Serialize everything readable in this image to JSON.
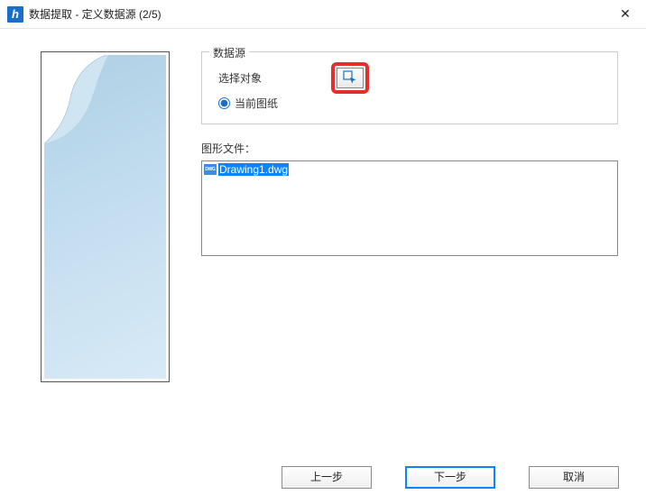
{
  "window": {
    "title": "数据提取 - 定义数据源 (2/5)"
  },
  "dataSource": {
    "groupTitle": "数据源",
    "selectObjectsLabel": "选择对象",
    "currentDrawingLabel": "当前图纸"
  },
  "drawings": {
    "label": "图形文件：",
    "items": [
      "Drawing1.dwg"
    ]
  },
  "footer": {
    "back": "上一步",
    "next": "下一步",
    "cancel": "取消"
  }
}
